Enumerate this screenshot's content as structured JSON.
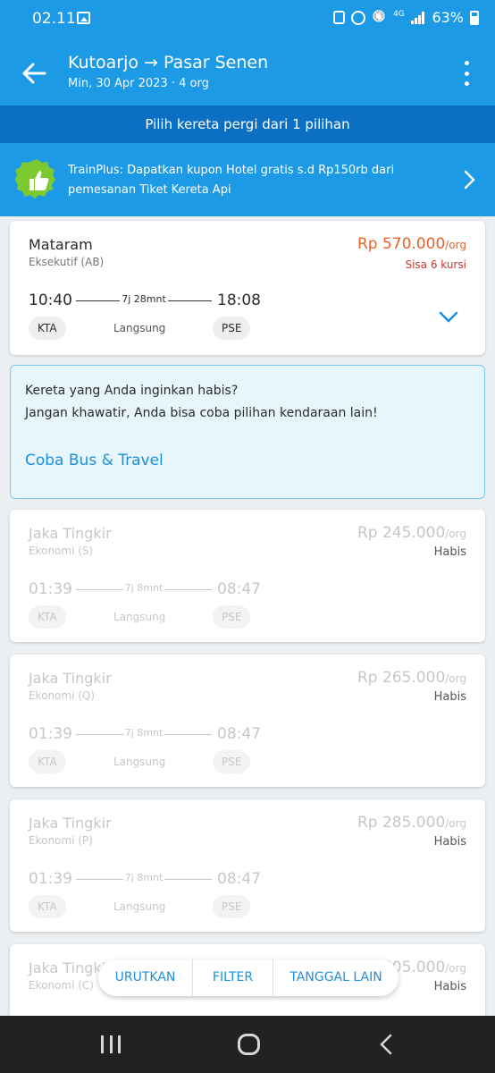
{
  "status_bar": {
    "time": "02.11",
    "network": "4G",
    "battery": "63%"
  },
  "header": {
    "route": "Kutoarjo → Pasar Senen",
    "subtitle": "Min, 30 Apr 2023 · 4 org"
  },
  "pick_banner": "Pilih kereta pergi dari 1 pilihan",
  "promo": {
    "text": "TrainPlus: Dapatkan kupon Hotel gratis s.d Rp150rb dari pemesanan Tiket Kereta Api"
  },
  "available_train": {
    "name": "Mataram",
    "class": "Eksekutif (AB)",
    "price": "Rp 570.000",
    "unit": "/org",
    "seats": "Sisa 6 kursi",
    "depart": "10:40",
    "arrive": "18:08",
    "duration": "7j 28mnt",
    "from_code": "KTA",
    "to_code": "PSE",
    "type": "Langsung"
  },
  "info_box": {
    "line1": "Kereta yang Anda inginkan habis?",
    "line2": "Jangan khawatir, Anda bisa coba pilihan kendaraan lain!",
    "link": "Coba Bus & Travel"
  },
  "sold_out_trains": [
    {
      "name": "Jaka Tingkir",
      "class": "Ekonomi (S)",
      "price": "Rp 245.000",
      "unit": "/org",
      "status": "Habis",
      "depart": "01:39",
      "arrive": "08:47",
      "duration": "7j 8mnt",
      "from_code": "KTA",
      "to_code": "PSE",
      "type": "Langsung"
    },
    {
      "name": "Jaka Tingkir",
      "class": "Ekonomi (Q)",
      "price": "Rp 265.000",
      "unit": "/org",
      "status": "Habis",
      "depart": "01:39",
      "arrive": "08:47",
      "duration": "7j 8mnt",
      "from_code": "KTA",
      "to_code": "PSE",
      "type": "Langsung"
    },
    {
      "name": "Jaka Tingkir",
      "class": "Ekonomi (P)",
      "price": "Rp 285.000",
      "unit": "/org",
      "status": "Habis",
      "depart": "01:39",
      "arrive": "08:47",
      "duration": "7j 8mnt",
      "from_code": "KTA",
      "to_code": "PSE",
      "type": "Langsung"
    },
    {
      "name": "Jaka Tingkir",
      "class": "Ekonomi (C)",
      "price": "Rp 305.000",
      "unit": "/org",
      "status": "Habis"
    }
  ],
  "bottom_bar": {
    "sort": "URUTKAN",
    "filter": "FILTER",
    "other_date": "TANGGAL LAIN"
  },
  "colors": {
    "primary": "#1d9ae6",
    "banner": "#0b6fc3",
    "price": "#e3642c",
    "seats": "#d0342c",
    "link": "#1d8fd9"
  }
}
